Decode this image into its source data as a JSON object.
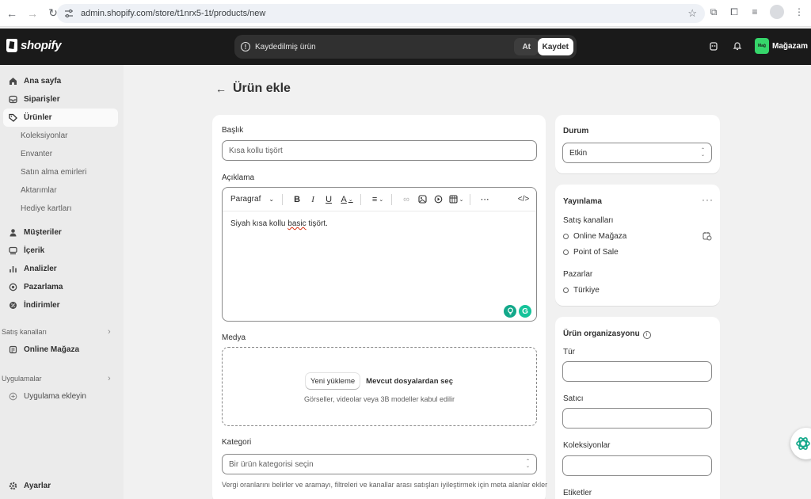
{
  "browser": {
    "url": "admin.shopify.com/store/t1nrx5-1t/products/new"
  },
  "topbar": {
    "logo_text": "shopify",
    "savebar_text": "Kaydedilmiş ürün",
    "discard_label": "At",
    "save_label": "Kaydet",
    "store_avatar_text": "Mağ",
    "store_name": "Mağazam"
  },
  "sidebar": {
    "items": [
      {
        "label": "Ana sayfa",
        "icon": "home-icon"
      },
      {
        "label": "Siparişler",
        "icon": "inbox-icon"
      },
      {
        "label": "Ürünler",
        "icon": "tag-icon"
      },
      {
        "label": "Müşteriler",
        "icon": "person-icon"
      },
      {
        "label": "İçerik",
        "icon": "content-icon"
      },
      {
        "label": "Analizler",
        "icon": "chart-icon"
      },
      {
        "label": "Pazarlama",
        "icon": "target-icon"
      },
      {
        "label": "İndirimler",
        "icon": "discount-icon"
      }
    ],
    "sub_items": [
      "Koleksiyonlar",
      "Envanter",
      "Satın alma emirleri",
      "Aktarımlar",
      "Hediye kartları"
    ],
    "sales_channels_label": "Satış kanalları",
    "online_store": "Online Mağaza",
    "apps_label": "Uygulamalar",
    "add_app": "Uygulama ekleyin",
    "settings": "Ayarlar"
  },
  "page": {
    "title": "Ürün ekle"
  },
  "product": {
    "title_label": "Başlık",
    "title_placeholder": "Kısa kollu tişört",
    "description_label": "Açıklama",
    "toolbar_paragraph": "Paragraf",
    "description_before": "Siyah kısa kollu ",
    "description_spell": "basic",
    "description_after": " tişört.",
    "media_label": "Medya",
    "upload_new": "Yeni yükleme",
    "select_existing": "Mevcut dosyalardan seç",
    "media_hint": "Görseller, videolar veya 3B modeller kabul edilir",
    "category_label": "Kategori",
    "category_placeholder": "Bir ürün kategorisi seçin",
    "category_help": "Vergi oranlarını belirler ve aramayı, filtreleri ve kanallar arası satışları iyileştirmek için meta alanlar ekler"
  },
  "status": {
    "label": "Durum",
    "value": "Etkin"
  },
  "publishing": {
    "label": "Yayınlama",
    "channels_label": "Satış kanalları",
    "channels": [
      "Online Mağaza",
      "Point of Sale"
    ],
    "markets_label": "Pazarlar",
    "markets": [
      "Türkiye"
    ]
  },
  "organization": {
    "label": "Ürün organizasyonu",
    "type_label": "Tür",
    "vendor_label": "Satıcı",
    "collections_label": "Koleksiyonlar",
    "tags_label": "Etiketler"
  }
}
